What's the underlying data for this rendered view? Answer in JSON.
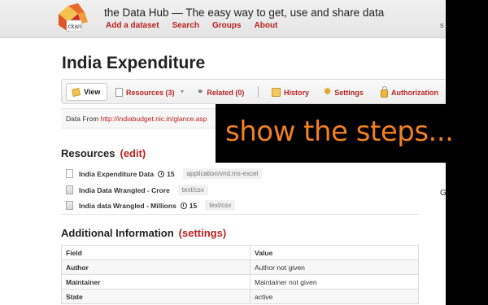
{
  "header": {
    "site_title": "the Data Hub — The easy way to get, use and share data",
    "logo_text": "ckan",
    "nav": [
      "Add a dataset",
      "Search",
      "Groups",
      "About"
    ],
    "right_fragment": "s"
  },
  "page_title": "India Expenditure",
  "tabs": {
    "view": "View",
    "resources": "Resources (3)",
    "related": "Related (0)",
    "history": "History",
    "settings": "Settings",
    "authorization": "Authorization"
  },
  "data_from": {
    "label": "Data From",
    "url": "http://indiabudget.nic.in/glance.asp"
  },
  "resources": {
    "heading": "Resources",
    "edit_label": "(edit)",
    "items": [
      {
        "name": "India Expenditure Data",
        "count": "15",
        "format": "application/vnd.ms-excel"
      },
      {
        "name": "India Data Wrangled - Crore",
        "count": "",
        "format": "text/csv"
      },
      {
        "name": "India data Wrangled - Millions",
        "count": "15",
        "format": "text/csv"
      }
    ]
  },
  "additional": {
    "heading": "Additional Information",
    "settings_label": "(settings)",
    "columns": [
      "Field",
      "Value"
    ],
    "rows": [
      {
        "field": "Author",
        "value": "Author not given"
      },
      {
        "field": "Maintainer",
        "value": "Maintainer not given"
      },
      {
        "field": "State",
        "value": "active"
      }
    ]
  },
  "side_fragment": "G",
  "overlay": {
    "text": "show the steps..."
  },
  "colors": {
    "link": "#bb2222",
    "overlay_text": "#f08020",
    "overlay_bg": "#000000"
  }
}
